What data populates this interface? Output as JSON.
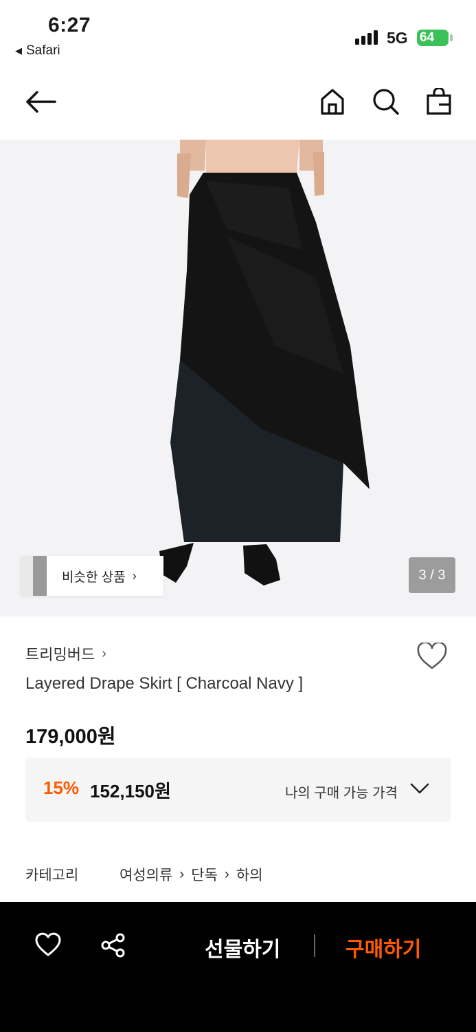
{
  "status": {
    "time": "6:27",
    "back_app": "Safari",
    "network": "5G",
    "battery": "64"
  },
  "nav": {
    "icons": [
      "back-arrow-icon",
      "home-icon",
      "search-icon",
      "shopping-bag-icon"
    ]
  },
  "gallery": {
    "similar_label": "비슷한 상품",
    "counter": "3 / 3"
  },
  "product": {
    "brand": "트리밍버드",
    "name": "Layered Drape Skirt [ Charcoal Navy ]",
    "price": "179,000원",
    "discount_rate": "15%",
    "discount_price": "152,150원",
    "my_price_label": "나의 구매 가능 가격"
  },
  "category": {
    "label": "카테고리",
    "path": [
      "여성의류",
      "단독",
      "하의"
    ]
  },
  "bottom_bar": {
    "gift_label": "선물하기",
    "buy_label": "구매하기"
  },
  "colors": {
    "accent": "#ff5a00",
    "battery": "#3cc15a",
    "bottom_bar": "#000000"
  }
}
